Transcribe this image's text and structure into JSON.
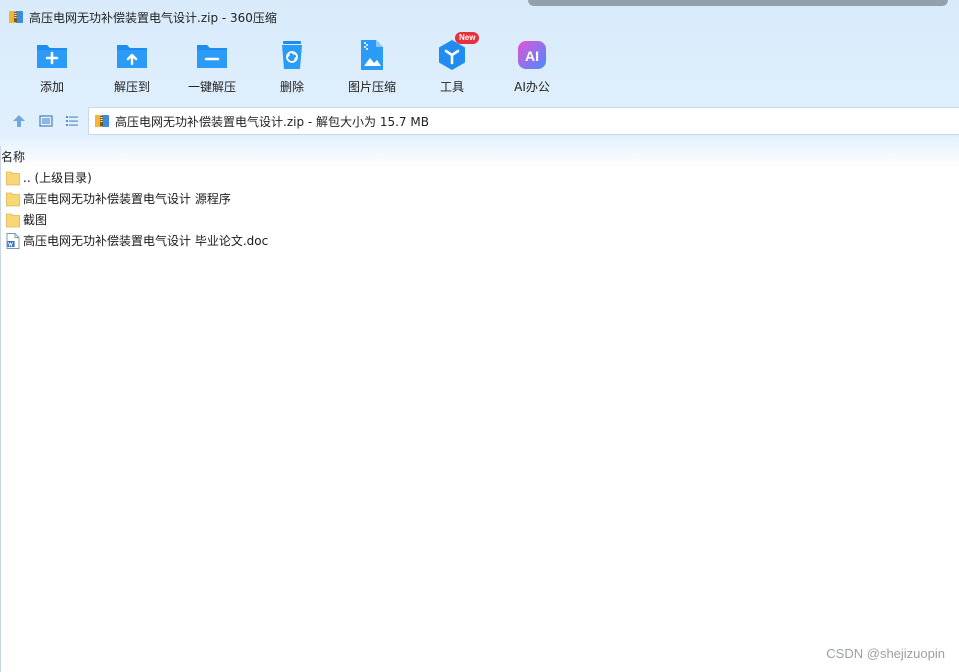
{
  "window": {
    "title": "高压电网无功补偿装置电气设计.zip - 360压缩",
    "icon": "zip-archive-icon"
  },
  "toolbar": {
    "items": [
      {
        "label": "添加",
        "icon": "add-icon"
      },
      {
        "label": "解压到",
        "icon": "extract-to-icon"
      },
      {
        "label": "一键解压",
        "icon": "one-click-extract-icon"
      },
      {
        "label": "删除",
        "icon": "delete-icon"
      },
      {
        "label": "图片压缩",
        "icon": "image-compress-icon"
      },
      {
        "label": "工具",
        "icon": "tools-icon",
        "badge": "New"
      },
      {
        "label": "AI办公",
        "icon": "ai-office-icon",
        "icon_text": "AI"
      }
    ]
  },
  "nav": {
    "path": "高压电网无功补偿装置电气设计.zip - 解包大小为 15.7 MB"
  },
  "filelist": {
    "column_name": "名称",
    "rows": [
      {
        "name": ".. (上级目录)",
        "type": "folder"
      },
      {
        "name": "高压电网无功补偿装置电气设计 源程序",
        "type": "folder"
      },
      {
        "name": "截图",
        "type": "folder"
      },
      {
        "name": "高压电网无功补偿装置电气设计 毕业论文.doc",
        "type": "doc"
      }
    ]
  },
  "watermark": "CSDN @shejizuopin",
  "colors": {
    "toolbar_bg": "#d9ebfb",
    "icon_blue": "#1e8cf0",
    "badge_red": "#e8313a",
    "ai_gradient_start": "#e054d6",
    "ai_gradient_end": "#4a8cff",
    "folder_yellow": "#f8d776"
  }
}
